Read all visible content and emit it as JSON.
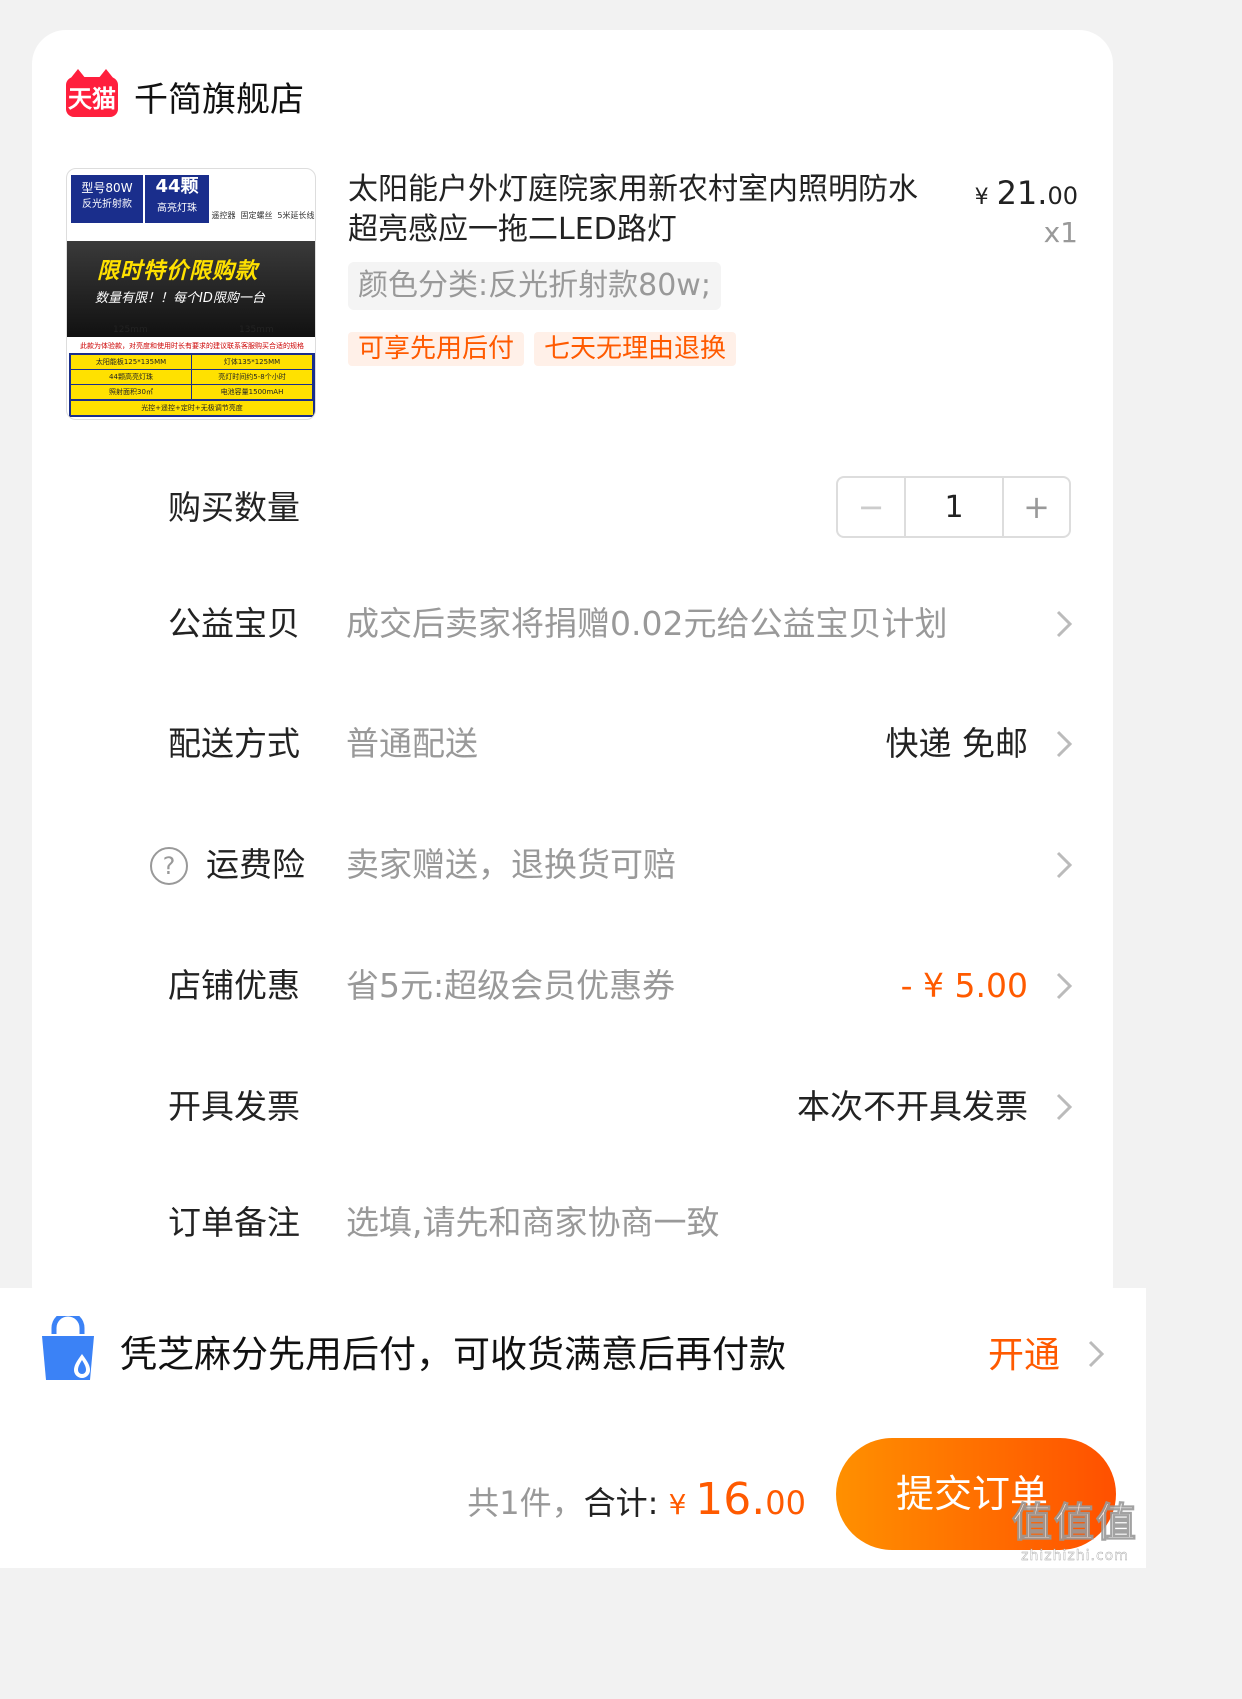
{
  "shop": {
    "badge": "天猫",
    "name": "千简旗舰店"
  },
  "product": {
    "title": "太阳能户外灯庭院家用新农村室内照明防水超亮感应一拖二LED路灯",
    "price_currency": "¥",
    "price_int": "21.",
    "price_dec": "00",
    "quantity_mark": "x1",
    "sku": "颜色分类:反光折射款80w;",
    "tags": [
      "可享先用后付",
      "七天无理由退换"
    ],
    "thumb": {
      "model": "型号80W",
      "model_sub": "反光折射款",
      "beads": "44颗",
      "beads_sub": "高亮灯珠",
      "acc1": "遥控器",
      "acc2": "固定螺丝",
      "acc3": "5米延长线",
      "promo": "限时特价限购款",
      "promo_sub": "数量有限！！每个ID限购一台",
      "dim1": "125mm",
      "dim2": "135mm",
      "note": "此款为体验款，对亮度和使用时长有要求的建议联系客服购买合适的规格",
      "spec": [
        "太阳能板125*135MM",
        "灯体135*125MM",
        "44颗高亮灯珠",
        "亮灯时间约5-8个小时",
        "照射面积30㎡",
        "电池容量1500mAH"
      ],
      "foot": "光控+遥控+定时+无极调节亮度"
    }
  },
  "quantity": {
    "label": "购买数量",
    "minus": "−",
    "value": "1",
    "plus": "+"
  },
  "charity": {
    "label": "公益宝贝",
    "value": "成交后卖家将捐赠0.02元给公益宝贝计划"
  },
  "delivery": {
    "label": "配送方式",
    "value": "普通配送",
    "right": "快递 免邮"
  },
  "insurance": {
    "icon": "?",
    "label": "运费险",
    "value": "卖家赠送，退换货可赔"
  },
  "discount": {
    "label": "店铺优惠",
    "value": "省5元:超级会员优惠券",
    "right": "- ¥ 5.00"
  },
  "invoice": {
    "label": "开具发票",
    "right": "本次不开具发票"
  },
  "remark": {
    "label": "订单备注",
    "placeholder": "选填,请先和商家协商一致"
  },
  "credit_pay": {
    "text": "凭芝麻分先用后付，可收货满意后再付款",
    "action": "开通"
  },
  "footer": {
    "count": "共1件，",
    "sum_label": "合计:",
    "currency": "¥ ",
    "amount_int": "16.",
    "amount_dec": "00",
    "submit": "提交订单"
  },
  "watermark": {
    "line1": "值值值",
    "line2": "zhizhizhi.com"
  },
  "colors": {
    "accent": "#ff5a00",
    "tmall_red": "#ff1f3d",
    "button_gradient_start": "#ff9000",
    "button_gradient_end": "#ff5000",
    "credit_icon": "#3b82f6"
  }
}
